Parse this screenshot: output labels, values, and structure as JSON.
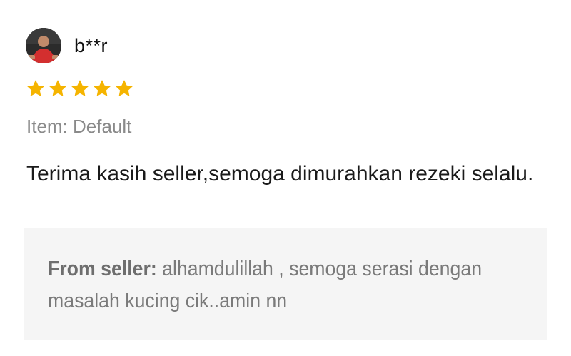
{
  "review": {
    "reviewer_name": "b**r",
    "avatar": "reviewer-avatar-photo",
    "rating": 5,
    "rating_max": 5,
    "star_color": "#F5B400",
    "variation_text": "Item: Default",
    "comment": "Terima kasih seller,semoga dimurahkan rezeki selalu.",
    "seller_reply": {
      "label": "From seller:",
      "text": " alhamdulillah , semoga serasi dengan masalah kucing cik..amin nn"
    }
  }
}
